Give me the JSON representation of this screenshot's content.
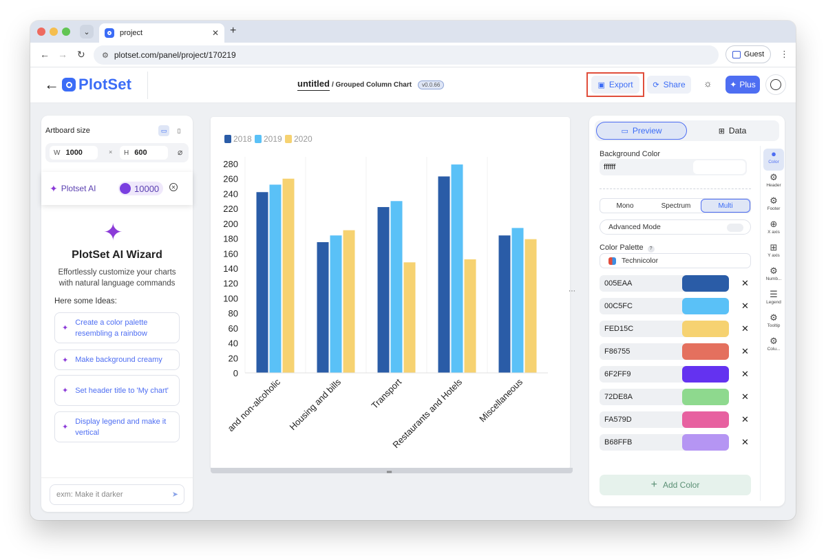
{
  "browser": {
    "tab_title": "project",
    "url": "plotset.com/panel/project/170219",
    "profile_label": "Guest"
  },
  "header": {
    "logo_text": "PlotSet",
    "doc_name": "untitled",
    "doc_type": "/ Grouped Column Chart",
    "version": "v0.0.66",
    "export_label": "Export",
    "share_label": "Share",
    "plus_label": "Plus"
  },
  "left": {
    "artboard_label": "Artboard size",
    "width_label": "W",
    "width_value": "1000",
    "height_label": "H",
    "height_value": "600",
    "ai_label": "Plotset AI",
    "credits": "10000",
    "wizard_title": "PlotSet AI Wizard",
    "wizard_subtitle": "Effortlessly customize your charts with natural language commands",
    "ideas_label": "Here some Ideas:",
    "ideas": [
      "Create a color palette resembling a rainbow",
      "Make background creamy",
      "Set header title to 'My chart'",
      "Display legend and make it vertical"
    ],
    "chat_placeholder": "exm: Make it darker"
  },
  "right": {
    "tab_preview": "Preview",
    "tab_data": "Data",
    "bg_label": "Background Color",
    "bg_value": "ffffff",
    "mode_mono": "Mono",
    "mode_spectrum": "Spectrum",
    "mode_multi": "Multi",
    "advanced_label": "Advanced Mode",
    "palette_label": "Color Palette",
    "palette_help": "?",
    "palette_value": "Technicolor",
    "colors": [
      "005EAA",
      "00C5FC",
      "FED15C",
      "F86755",
      "6F2FF9",
      "72DE8A",
      "FA579D",
      "B68FFB"
    ],
    "color_swatches": [
      "#2a5ca7",
      "#5ac1f7",
      "#f6d271",
      "#e4705e",
      "#6432f0",
      "#8ed98e",
      "#e761a0",
      "#b595f3"
    ],
    "add_color_label": "Add Color",
    "side_tabs": [
      "Color",
      "Header",
      "Footer",
      "X axis",
      "Y axis",
      "Numb...",
      "Legend",
      "Tooltip",
      "Colu..."
    ]
  },
  "chart_data": {
    "type": "bar",
    "categories": [
      "and non-alcoholic",
      "Housing and bills",
      "Transport",
      "Restaurants and Hotels",
      "Miscellaneous"
    ],
    "series": [
      {
        "name": "2018",
        "values": [
          242,
          175,
          222,
          263,
          184
        ],
        "color": "#2a5ca7"
      },
      {
        "name": "2019",
        "values": [
          252,
          184,
          230,
          279,
          194
        ],
        "color": "#5ac1f7"
      },
      {
        "name": "2020",
        "values": [
          260,
          191,
          148,
          152,
          179
        ],
        "color": "#f6d271"
      }
    ],
    "yticks": [
      "280",
      "260",
      "240",
      "220",
      "200",
      "180",
      "160",
      "140",
      "120",
      "100",
      "80",
      "60",
      "40",
      "20",
      "0"
    ],
    "ylim": [
      0,
      280
    ],
    "legend_position": "top-left"
  }
}
